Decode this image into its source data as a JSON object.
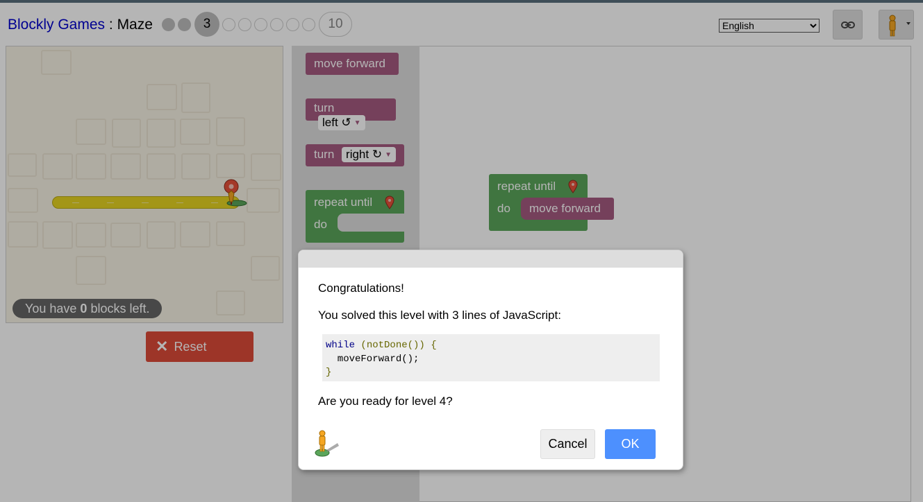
{
  "header": {
    "app_name": "Blockly Games",
    "separator": " : ",
    "page_name": "Maze",
    "current_level": "3",
    "last_level": "10",
    "language": "English",
    "language_options": [
      "English"
    ]
  },
  "maze": {
    "blocks_left_prefix": "You have ",
    "blocks_left_count": "0",
    "blocks_left_suffix": " blocks left.",
    "reset_label": "Reset"
  },
  "toolbox": {
    "move_forward": "move forward",
    "turn": "turn",
    "turn_left": "left ↺",
    "turn_right": "right ↻",
    "repeat_until": "repeat until",
    "do": "do"
  },
  "workspace": {
    "repeat_until": "repeat until",
    "do": "do",
    "move_forward": "move forward"
  },
  "dialog": {
    "congrats": "Congratulations!",
    "solved_text": "You solved this level with 3 lines of JavaScript:",
    "code_line1_kw": "while",
    "code_line1_rest": " (notDone()) {",
    "code_line2": "  moveForward();",
    "code_line3": "}",
    "ready_text": "Are you ready for level 4?",
    "cancel_label": "Cancel",
    "ok_label": "OK"
  },
  "colors": {
    "movement_block": "#a55b80",
    "loop_block": "#5ba55b",
    "ok_button": "#4d90fe",
    "reset_button": "#dd4b39",
    "link": "#0000cc"
  }
}
